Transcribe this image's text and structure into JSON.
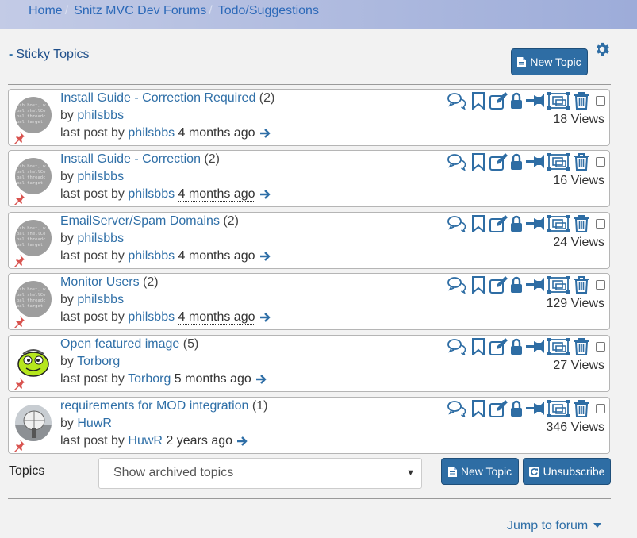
{
  "breadcrumb": {
    "items": [
      "Home",
      "Snitz MVC Dev Forums",
      "Todo/Suggestions"
    ],
    "separator": "/"
  },
  "sticky_toggle": {
    "symbol": "-",
    "label": "Sticky Topics"
  },
  "toolbar": {
    "new_topic_label": "New Topic"
  },
  "topics": [
    {
      "title": "Install Guide - Correction Required",
      "replies": "(2)",
      "by_prefix": "by",
      "author": "philsbbs",
      "last_post_prefix": "last post by",
      "last_post_author": "philsbbs",
      "last_post_ago": "4 months ago",
      "views": "18 Views",
      "avatar": "terminal"
    },
    {
      "title": "Install Guide - Correction",
      "replies": "(2)",
      "by_prefix": "by",
      "author": "philsbbs",
      "last_post_prefix": "last post by",
      "last_post_author": "philsbbs",
      "last_post_ago": "4 months ago",
      "views": "16 Views",
      "avatar": "terminal"
    },
    {
      "title": "EmailServer/Spam Domains",
      "replies": "(2)",
      "by_prefix": "by",
      "author": "philsbbs",
      "last_post_prefix": "last post by",
      "last_post_author": "philsbbs",
      "last_post_ago": "4 months ago",
      "views": "24 Views",
      "avatar": "terminal"
    },
    {
      "title": "Monitor Users",
      "replies": "(2)",
      "by_prefix": "by",
      "author": "philsbbs",
      "last_post_prefix": "last post by",
      "last_post_author": "philsbbs",
      "last_post_ago": "4 months ago",
      "views": "129 Views",
      "avatar": "terminal"
    },
    {
      "title": "Open featured image",
      "replies": "(5)",
      "by_prefix": "by",
      "author": "Torborg",
      "last_post_prefix": "last post by",
      "last_post_author": "Torborg",
      "last_post_ago": "5 months ago",
      "views": "27 Views",
      "avatar": "cartoon"
    },
    {
      "title": "requirements for MOD integration",
      "replies": "(1)",
      "by_prefix": "by",
      "author": "HuwR",
      "last_post_prefix": "last post by",
      "last_post_author": "HuwR",
      "last_post_ago": "2 years ago",
      "views": "346 Views",
      "avatar": "photo"
    }
  ],
  "footer": {
    "topics_label": "Topics",
    "archive_select": {
      "selected": "Show archived topics"
    },
    "new_topic_label": "New Topic",
    "unsubscribe_label": "Unsubscribe",
    "jump_label": "Jump to forum"
  },
  "icons": [
    "reply-icon",
    "bookmark-icon",
    "edit-icon",
    "lock-icon",
    "pin-icon",
    "move-icon",
    "delete-icon",
    "select-checkbox",
    "gear-icon",
    "pushpin-icon",
    "arrow-right-icon",
    "document-icon",
    "refresh-icon",
    "caret-down-icon"
  ],
  "colors": {
    "link": "#2f6fa7",
    "button": "#2e6da4",
    "icon": "#2e6da4",
    "pin": "#d9534f",
    "breadcrumb_bg": "#a9b6de"
  }
}
